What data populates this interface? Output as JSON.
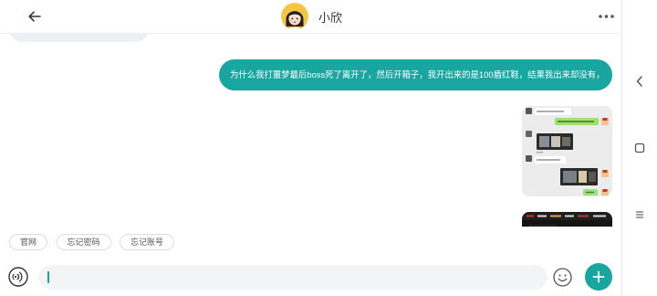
{
  "colors": {
    "accent": "#19a6a1",
    "incoming_bubble": "#eef0f3",
    "input_background": "#f2f4f6",
    "page_background": "#ffffff"
  },
  "header": {
    "back_icon": "arrow-left-icon",
    "avatar_icon": "girl-avatar-icon",
    "contact_name": "小欣",
    "more_icon": "more-dots-icon"
  },
  "chat": {
    "outgoing_text": "为什么我打噩梦最后boss死了离开了，然后开箱子，我开出来的是100盾红鞋，结果我出来却没有，",
    "outgoing_images": [
      {
        "icon": "chat-screenshot-image"
      },
      {
        "icon": "game-screenshot-image"
      }
    ]
  },
  "quick_replies": [
    "官网",
    "忘记密码",
    "忘记账号"
  ],
  "composer": {
    "voice_icon": "voice-input-icon",
    "input_value": "",
    "input_placeholder": "",
    "emoji_icon": "emoji-icon",
    "add_icon": "plus-icon"
  },
  "system_nav": {
    "back_icon": "nav-back-icon",
    "overview_icon": "nav-square-icon",
    "menu_icon": "nav-menu-icon"
  }
}
